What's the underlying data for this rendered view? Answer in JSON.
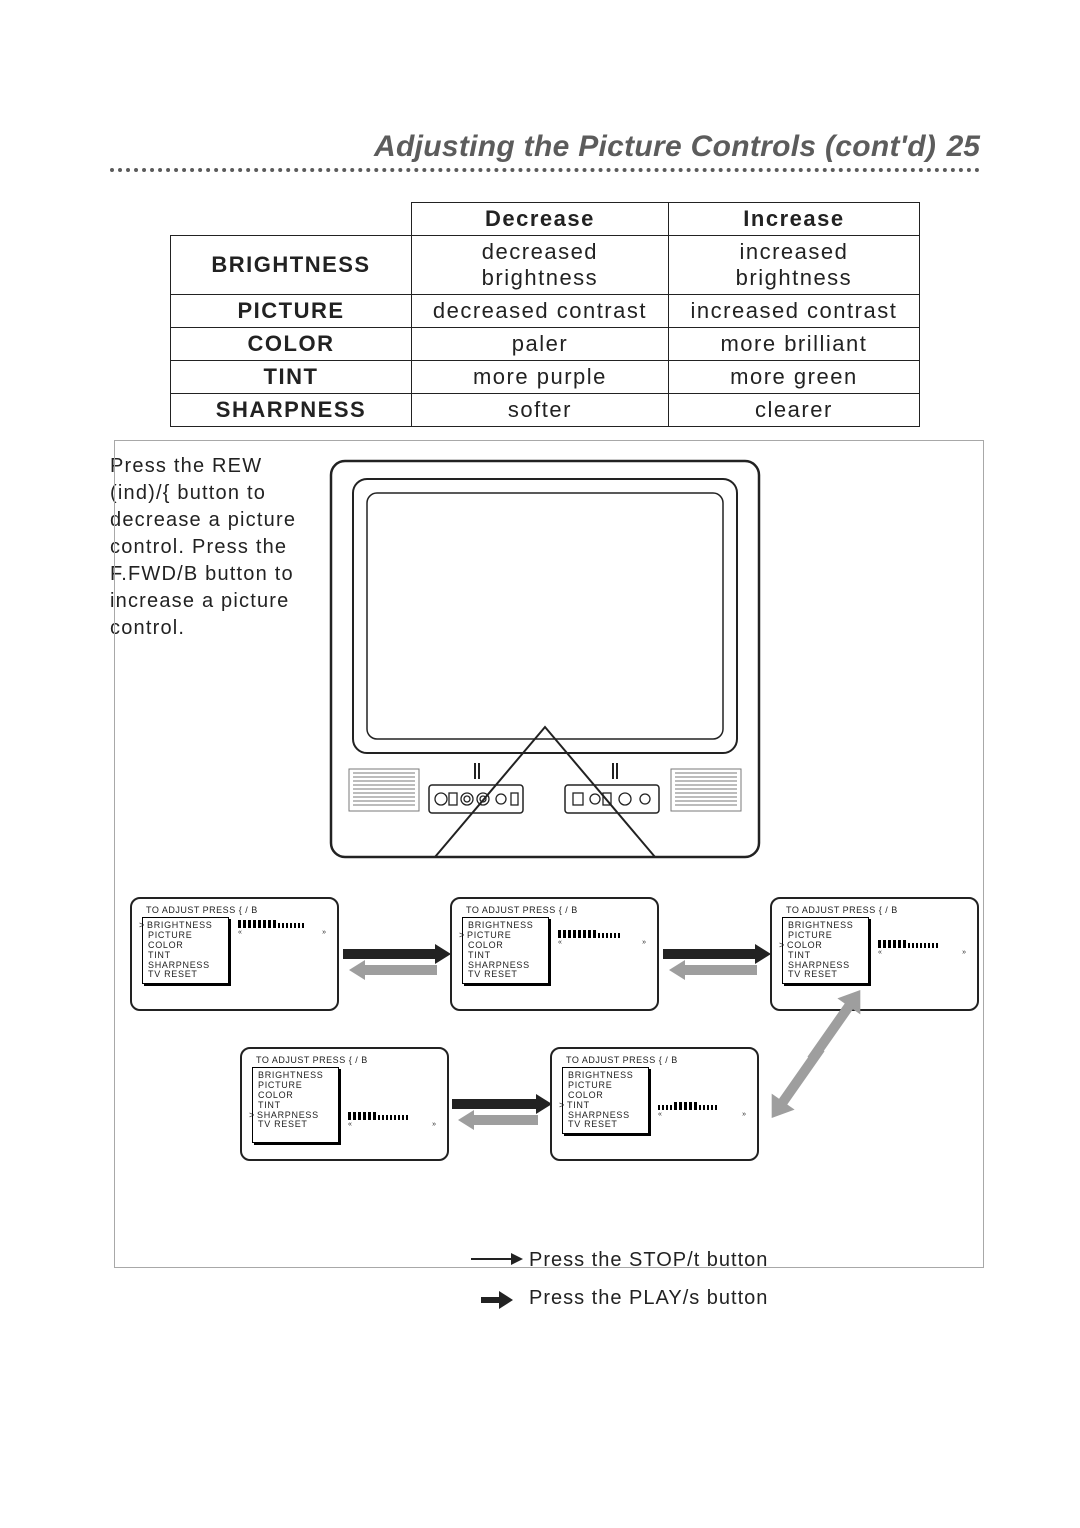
{
  "header": {
    "title": "Adjusting the Picture Controls (cont'd)",
    "page_number": "25"
  },
  "table": {
    "headers": {
      "decrease": "Decrease",
      "increase": "Increase"
    },
    "rows": [
      {
        "label": "BRIGHTNESS",
        "decrease": "decreased brightness",
        "increase": "increased brightness"
      },
      {
        "label": "PICTURE",
        "decrease": "decreased contrast",
        "increase": "increased contrast"
      },
      {
        "label": "COLOR",
        "decrease": "paler",
        "increase": "more brilliant"
      },
      {
        "label": "TINT",
        "decrease": "more purple",
        "increase": "more green"
      },
      {
        "label": "SHARPNESS",
        "decrease": "softer",
        "increase": "clearer"
      }
    ]
  },
  "instructions": "Press the REW (ind)/{ button to decrease a picture control. Press the F.FWD/B button to increase a picture control.",
  "menu": {
    "header": "TO ADJUST PRESS { / B",
    "items": [
      "BRIGHTNESS",
      "PICTURE",
      "COLOR",
      "TINT",
      "SHARPNESS",
      "TV RESET"
    ]
  },
  "screens": [
    {
      "id": "brightness",
      "selected": 0
    },
    {
      "id": "picture",
      "selected": 1
    },
    {
      "id": "color",
      "selected": 2
    },
    {
      "id": "sharpness",
      "selected": 4
    },
    {
      "id": "tint",
      "selected": 3
    }
  ],
  "legend": {
    "stop": "Press the STOP/t button",
    "play": "Press the PLAY/s button"
  }
}
